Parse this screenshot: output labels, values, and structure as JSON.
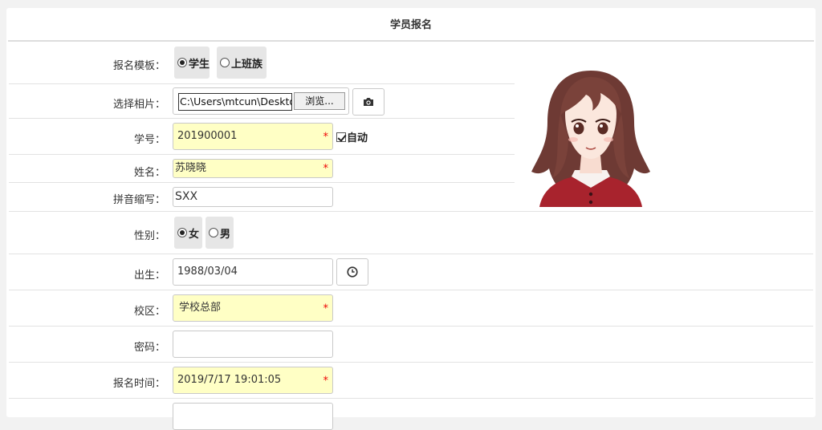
{
  "form_title": "学员报名",
  "template": {
    "label": "报名模板：",
    "options": [
      "学生",
      "上班族"
    ],
    "selected": "学生"
  },
  "photo": {
    "label": "选择相片：",
    "path": "C:\\Users\\mtcun\\Desktop",
    "browse_label": "浏览...",
    "camera_icon": "camera-icon"
  },
  "student_no": {
    "label": "学号：",
    "value": "201900001",
    "required_mark": "*",
    "auto_label": "自动",
    "auto_checked": true
  },
  "name": {
    "label": "姓名：",
    "value": "苏晓晓",
    "required_mark": "*"
  },
  "pinyin": {
    "label": "拼音缩写：",
    "value": "SXX"
  },
  "gender": {
    "label": "性别：",
    "options": [
      "女",
      "男"
    ],
    "selected": "女"
  },
  "birth": {
    "label": "出生：",
    "value": "1988/03/04",
    "clock_icon": "clock-icon"
  },
  "campus": {
    "label": "校区：",
    "value": "学校总部",
    "required_mark": "*"
  },
  "password": {
    "label": "密码：",
    "value": ""
  },
  "signup_time": {
    "label": "报名时间：",
    "value": "2019/7/17 19:01:05",
    "required_mark": "*"
  },
  "colors": {
    "required": "#ff0000",
    "highlight_bg": "#ffffc5",
    "radio_bg": "#e6e6e6"
  }
}
